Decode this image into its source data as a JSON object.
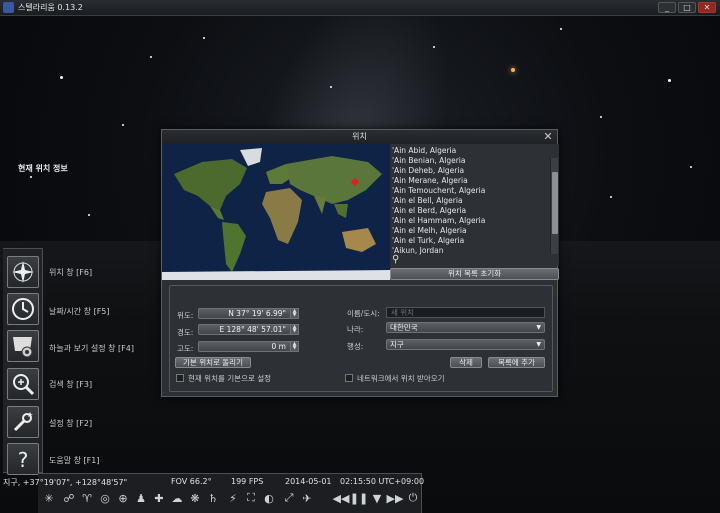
{
  "window": {
    "title": "스텔라리움 0.13.2",
    "minimize": "_",
    "maximize": "□",
    "close": "✕"
  },
  "left_toolbar": {
    "items": [
      {
        "label": "위치 창 [F6]",
        "icon": "compass-star-icon"
      },
      {
        "label": "날짜/시간 창 [F5]",
        "icon": "clock-icon"
      },
      {
        "label": "하늘과 보기 설정 창 [F4]",
        "icon": "sky-settings-icon"
      },
      {
        "label": "검색 창 [F3]",
        "icon": "search-icon"
      },
      {
        "label": "설정 창 [F2]",
        "icon": "wrench-icon"
      },
      {
        "label": "도움말 창 [F1]",
        "icon": "help-icon"
      }
    ]
  },
  "status": {
    "location": "지구, +37°19'07\", +128°48'57\"",
    "fov": "FOV 66.2°",
    "fps": "199 FPS",
    "date": "2014-05-01",
    "time": "02:15:50 UTC+09:00"
  },
  "dialog": {
    "title": "위치",
    "close": "✕",
    "locations": [
      "'Ain Abid, Algeria",
      "'Ain Benian, Algeria",
      "'Ain Deheb, Algeria",
      "'Ain Merane, Algeria",
      "'Ain Temouchent, Algeria",
      "'Ain el Bell, Algeria",
      "'Ain el Berd, Algeria",
      "'Ain el Hammam, Algeria",
      "'Ain el Melh, Algeria",
      "'Ain el Turk, Algeria",
      "'Aikun, Jordan"
    ],
    "reset_button": "위치 목록 초기화",
    "current_section_title": "현재 위치 정보",
    "latitude_label": "위도:",
    "latitude_value": "N 37° 19' 6.99\"",
    "longitude_label": "경도:",
    "longitude_value": "E 128° 48' 57.01\"",
    "altitude_label": "고도:",
    "altitude_value": "0 m",
    "name_label": "이름/도시:",
    "name_placeholder": "새 위치",
    "country_label": "나라:",
    "country_value": "대한민국",
    "planet_label": "행성:",
    "planet_value": "지구",
    "use_default_button": "기본 위치로 돌리기",
    "delete_button": "삭제",
    "add_button": "목록에 추가",
    "set_default_checkbox": "현재 위치를 기본으로 설정",
    "network_checkbox": "네트워크에서 위치 받아오기"
  },
  "colors": {
    "dialog_bg": "#2d3034",
    "ocean": "#0f2347",
    "land": "#4c6a2e",
    "marker": "#e02020"
  }
}
